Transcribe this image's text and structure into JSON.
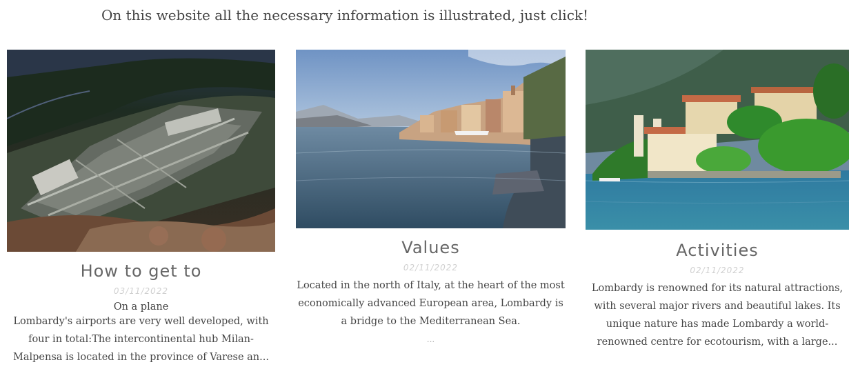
{
  "intro_text": "On this website all the necessary information is illustrated, just click!",
  "cards": [
    {
      "image_label": "aerial-airport-photo",
      "title": "How to get to",
      "date": "03/11/2022",
      "subtitle": "On a plane",
      "text": "Lombardy's airports are very well developed, with four in total:The intercontinental hub Milan-Malpensa is located in the province of Varese an..."
    },
    {
      "image_label": "lake-town-photo",
      "title": "Values",
      "date": "02/11/2022",
      "text": "Located in the north of Italy, at the heart of the most economically advanced European area, Lombardy is a bridge to the Mediterranean Sea.",
      "ellipsis": "..."
    },
    {
      "image_label": "lakeside-villa-photo",
      "title": "Activities",
      "date": "02/11/2022",
      "text": "Lombardy is renowned for its natural attractions, with several major rivers and beautiful lakes. Its unique nature has made Lombardy a world-renowned centre for ecotourism, with a large..."
    }
  ]
}
